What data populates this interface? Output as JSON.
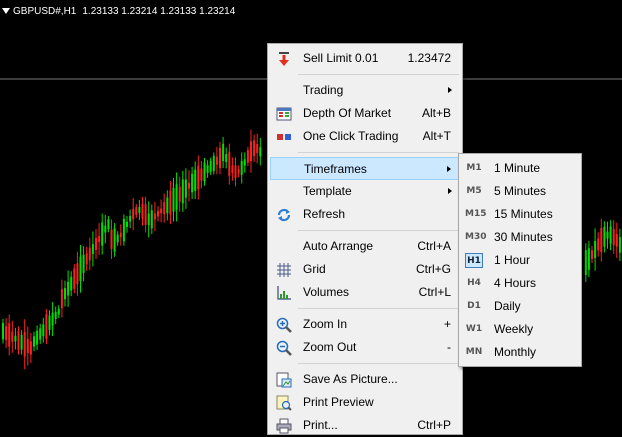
{
  "chart": {
    "symbol": "GBPUSD#,H1",
    "prices": "1.23133 1.23214 1.23133 1.23214",
    "bull_color": "#00e000",
    "bear_color": "#ff2020",
    "background": "#000000"
  },
  "context_menu": {
    "items": [
      {
        "label": "Sell Limit 0.01",
        "shortcut": "1.23472",
        "icon": "sell-limit-arrow-icon"
      },
      {
        "label": "Trading",
        "shortcut": "",
        "submenu": true
      },
      {
        "label": "Depth Of Market",
        "shortcut": "Alt+B",
        "icon": "depth-of-market-icon"
      },
      {
        "label": "One Click Trading",
        "shortcut": "Alt+T",
        "icon": "one-click-trading-icon"
      },
      {
        "label": "Timeframes",
        "shortcut": "",
        "submenu": true,
        "highlighted": true
      },
      {
        "label": "Template",
        "shortcut": "",
        "submenu": true
      },
      {
        "label": "Refresh",
        "shortcut": "",
        "icon": "refresh-icon"
      },
      {
        "label": "Auto Arrange",
        "shortcut": "Ctrl+A"
      },
      {
        "label": "Grid",
        "shortcut": "Ctrl+G",
        "icon": "grid-icon"
      },
      {
        "label": "Volumes",
        "shortcut": "Ctrl+L",
        "icon": "volumes-icon"
      },
      {
        "label": "Zoom In",
        "shortcut": "+",
        "icon": "zoom-in-icon"
      },
      {
        "label": "Zoom Out",
        "shortcut": "-",
        "icon": "zoom-out-icon"
      },
      {
        "label": "Save As Picture...",
        "shortcut": "",
        "icon": "save-picture-icon"
      },
      {
        "label": "Print Preview",
        "shortcut": "",
        "icon": "print-preview-icon"
      },
      {
        "label": "Print...",
        "shortcut": "Ctrl+P",
        "icon": "print-icon"
      }
    ]
  },
  "timeframes": {
    "selected": "H1",
    "items": [
      {
        "code": "M1",
        "label": "1 Minute"
      },
      {
        "code": "M5",
        "label": "5 Minutes"
      },
      {
        "code": "M15",
        "label": "15 Minutes"
      },
      {
        "code": "M30",
        "label": "30 Minutes"
      },
      {
        "code": "H1",
        "label": "1 Hour"
      },
      {
        "code": "H4",
        "label": "4 Hours"
      },
      {
        "code": "D1",
        "label": "Daily"
      },
      {
        "code": "W1",
        "label": "Weekly"
      },
      {
        "code": "MN",
        "label": "Monthly"
      }
    ]
  }
}
